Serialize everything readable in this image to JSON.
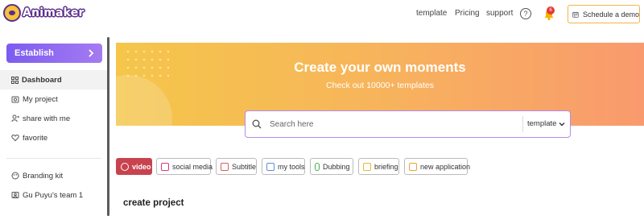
{
  "header": {
    "brand": "Animaker",
    "nav": [
      "template",
      "Pricing",
      "support"
    ],
    "help_icon": "question-circle-icon",
    "notification_count": "6",
    "demo_button": "Schedule a demo",
    "colors": {
      "brand_purple": "#5b2e8c",
      "demo_border": "#f1b547"
    }
  },
  "sidebar": {
    "establish_label": "Establish",
    "items": [
      {
        "label": "Dashboard",
        "icon": "grid-icon",
        "active": true
      },
      {
        "label": "My project",
        "icon": "folder-icon"
      },
      {
        "label": "share with me",
        "icon": "share-user-icon"
      },
      {
        "label": "favorite",
        "icon": "heart-icon"
      }
    ],
    "bottom_items": [
      {
        "label": "Branding kit",
        "icon": "palette-icon"
      },
      {
        "label": "Gu Puyu's team 1",
        "icon": "team-icon"
      }
    ]
  },
  "banner": {
    "title": "Create your own moments",
    "subtitle": "Check out 10000+ templates",
    "colors": {
      "start": "#f5c64a",
      "end": "#f99a6e"
    }
  },
  "search": {
    "placeholder": "Search here",
    "scope": "template"
  },
  "tabs": [
    {
      "label": "video",
      "active": true,
      "icon_color": "#ffffff"
    },
    {
      "label": "social media",
      "icon_color": "#d6387a"
    },
    {
      "label": "Subtitle",
      "icon_color": "#e05b5b"
    },
    {
      "label": "my tools",
      "icon_color": "#5b8de0"
    },
    {
      "label": "Dubbing",
      "icon_color": "#3fae4b"
    },
    {
      "label": "briefing",
      "icon_color": "#e8b92e"
    },
    {
      "label": "new application",
      "icon_color": "#f0a03a"
    }
  ],
  "main": {
    "section_title": "create project"
  }
}
